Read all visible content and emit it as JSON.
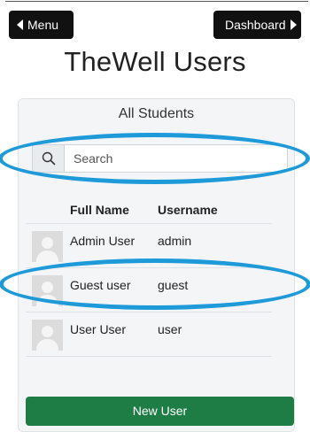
{
  "nav": {
    "menu_label": "Menu",
    "dashboard_label": "Dashboard"
  },
  "page_title": "TheWell Users",
  "card": {
    "title": "All Students",
    "search": {
      "placeholder": "Search",
      "value": ""
    },
    "table": {
      "headers": {
        "full_name": "Full Name",
        "username": "Username"
      },
      "rows": [
        {
          "full_name": "Admin User",
          "username": "admin"
        },
        {
          "full_name": "Guest user",
          "username": "guest"
        },
        {
          "full_name": "User User",
          "username": "user"
        }
      ]
    },
    "new_user_label": "New User"
  },
  "colors": {
    "nav_button": "#111111",
    "primary_green": "#1e7d45",
    "annotation_blue": "#1e9ad9",
    "card_background": "#f3f5f7"
  },
  "icons": {
    "menu": "caret-left-icon",
    "dashboard": "caret-right-icon",
    "search": "search-icon",
    "avatar": "avatar-placeholder-icon"
  }
}
